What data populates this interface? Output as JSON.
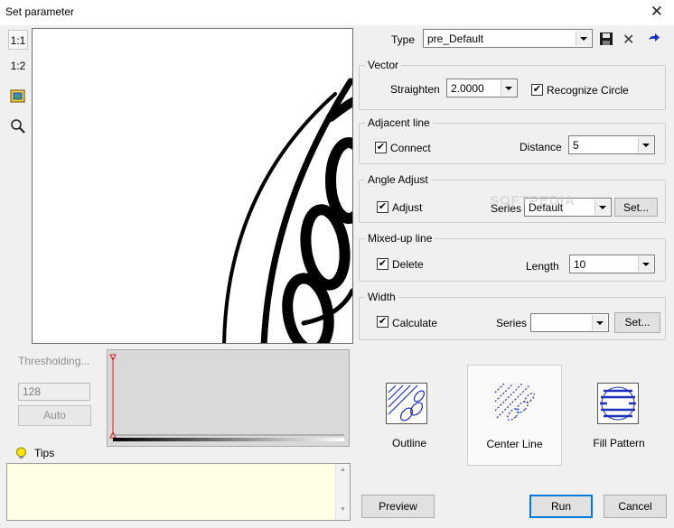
{
  "window": {
    "title": "Set parameter"
  },
  "toolbar": {
    "zoom_1_1": "1:1",
    "zoom_1_2": "1:2"
  },
  "threshold": {
    "label": "Thresholding...",
    "value": "128",
    "auto_label": "Auto"
  },
  "tips": {
    "label": "Tips",
    "text": ""
  },
  "type": {
    "label": "Type",
    "value": "pre_Default"
  },
  "vector": {
    "title": "Vector",
    "straighten_label": "Straighten",
    "straighten_value": "2.0000",
    "recognize_label": "Recognize Circle",
    "recognize_checked": true
  },
  "adjacent": {
    "title": "Adjacent line",
    "connect_label": "Connect",
    "connect_checked": true,
    "distance_label": "Distance",
    "distance_value": "5"
  },
  "angle": {
    "title": "Angle Adjust",
    "adjust_label": "Adjust",
    "adjust_checked": true,
    "series_label": "Series",
    "series_value": "Default",
    "set_label": "Set..."
  },
  "mixed": {
    "title": "Mixed-up line",
    "delete_label": "Delete",
    "delete_checked": true,
    "length_label": "Length",
    "length_value": "10"
  },
  "width": {
    "title": "Width",
    "calculate_label": "Calculate",
    "calculate_checked": true,
    "series_label": "Series",
    "series_value": "",
    "set_label": "Set..."
  },
  "modes": [
    {
      "label": "Outline",
      "selected": false
    },
    {
      "label": "Center Line",
      "selected": true
    },
    {
      "label": "Fill Pattern",
      "selected": false
    }
  ],
  "buttons": {
    "preview": "Preview",
    "run": "Run",
    "cancel": "Cancel"
  },
  "watermark": "SOFTPEDIA",
  "colors": {
    "accent": "#0078d7",
    "icon_blue": "#1c2fbf",
    "tips_bg": "#ffffe6"
  }
}
